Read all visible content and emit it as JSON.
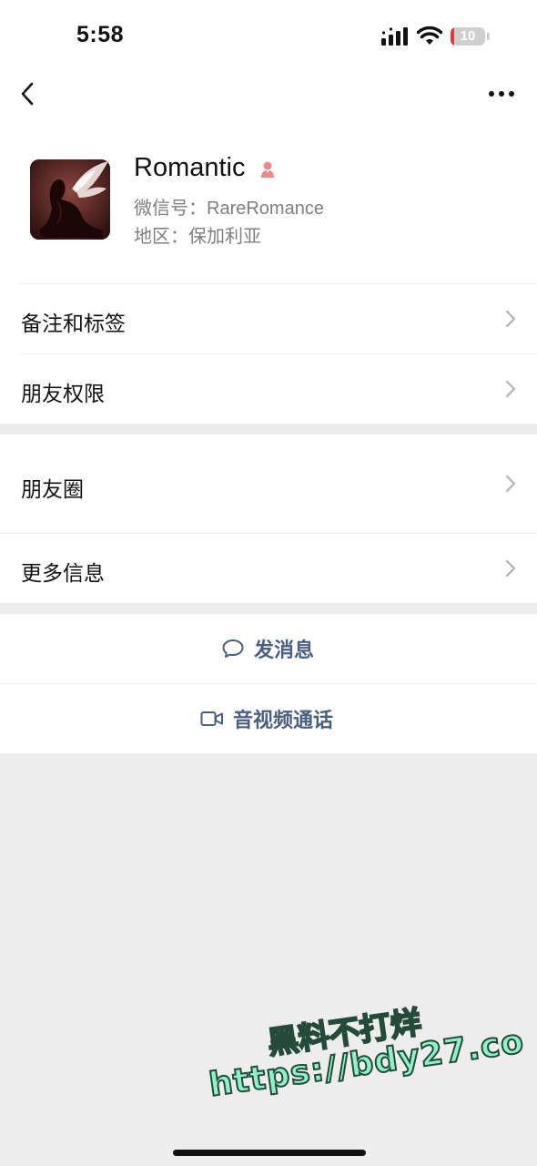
{
  "status_bar": {
    "time": "5:58",
    "battery_level": "10",
    "battery_fraction": 0.1,
    "icons": [
      "signal-icon",
      "wifi-icon",
      "battery-icon"
    ]
  },
  "nav": {
    "back_icon": "chevron-left-icon",
    "more_icon": "more-dots-icon"
  },
  "profile": {
    "name": "Romantic",
    "gender_icon": "female-icon",
    "wechat_id": "微信号：RareRomance",
    "region": "地区：保加利亚"
  },
  "menu_group_1": [
    {
      "label": "备注和标签"
    },
    {
      "label": "朋友权限"
    }
  ],
  "menu_group_2": [
    {
      "label": "朋友圈"
    },
    {
      "label": "更多信息"
    }
  ],
  "actions": {
    "send_message": "发消息",
    "video_call": "音视频通话"
  },
  "watermark": {
    "line1": "黑料不打烊",
    "line2": "https://bdy27.co"
  },
  "colors": {
    "accent_link": "#4a5f84",
    "background": "#ededed",
    "battery_low": "#e03a3a",
    "gender_female": "#e88a8a",
    "watermark_fill": "#8ff2c7"
  }
}
